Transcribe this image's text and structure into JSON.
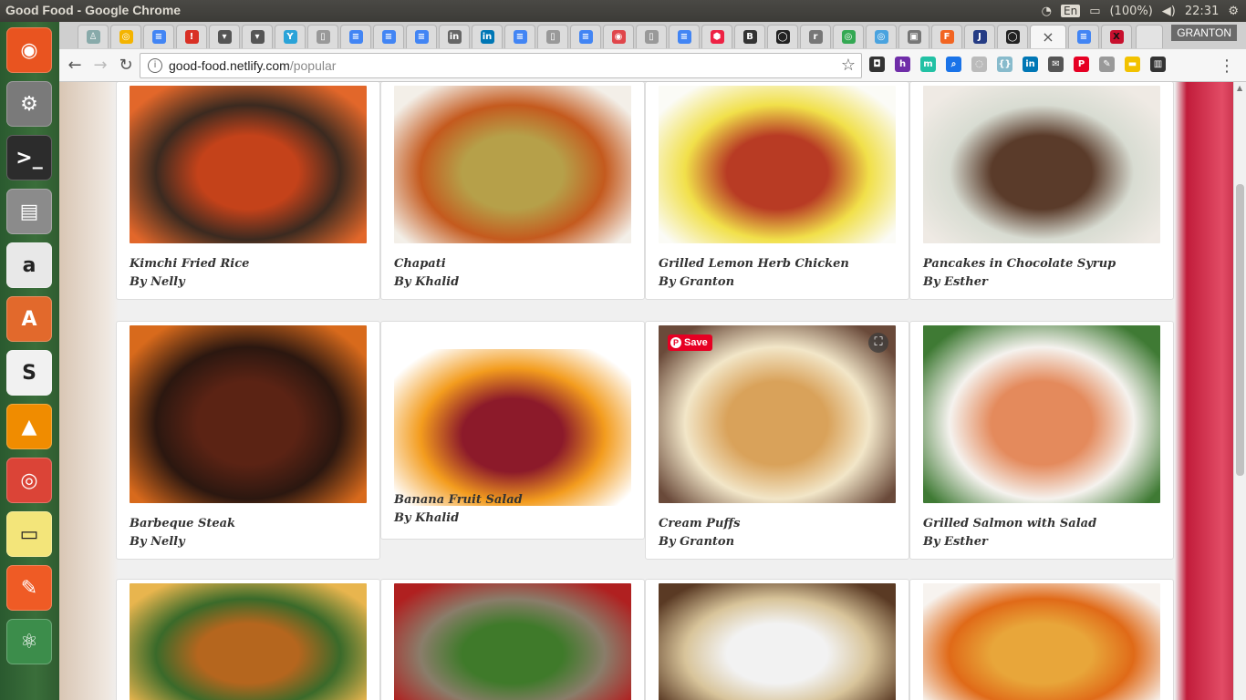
{
  "os": {
    "window_title": "Good Food - Google Chrome",
    "lang": "En",
    "battery": "(100%)",
    "clock": "22:31"
  },
  "launcher": [
    {
      "name": "ubuntu-dash-icon",
      "glyph": "◉",
      "color": "#e95420"
    },
    {
      "name": "system-settings-icon",
      "glyph": "⚙",
      "color": "#7a7a7a"
    },
    {
      "name": "terminal-icon",
      "glyph": ">_",
      "color": "#2c2c2c"
    },
    {
      "name": "files-icon",
      "glyph": "▤",
      "color": "#8b8b8b"
    },
    {
      "name": "amazon-icon",
      "glyph": "a",
      "color": "#e8e8e8"
    },
    {
      "name": "software-center-icon",
      "glyph": "A",
      "color": "#e2692c"
    },
    {
      "name": "slack-icon",
      "glyph": "S",
      "color": "#f1f1f1"
    },
    {
      "name": "vlc-icon",
      "glyph": "▲",
      "color": "#f08c00"
    },
    {
      "name": "chrome-icon",
      "glyph": "◎",
      "color": "#db4437"
    },
    {
      "name": "sticky-notes-icon",
      "glyph": "▭",
      "color": "#f3e57a"
    },
    {
      "name": "postman-icon",
      "glyph": "✎",
      "color": "#ef5b25"
    },
    {
      "name": "atom-icon",
      "glyph": "⚛",
      "color": "#3c8d4b"
    }
  ],
  "browser": {
    "tabs": [
      {
        "name": "tab-app",
        "glyph": "♙",
        "color": "#8aa",
        "fg": "#fff"
      },
      {
        "name": "tab-chrome",
        "glyph": "◎",
        "color": "#f4b400",
        "fg": "#fff"
      },
      {
        "name": "tab-docs-1",
        "glyph": "≡",
        "color": "#4285f4",
        "fg": "#fff"
      },
      {
        "name": "tab-alert",
        "glyph": "!",
        "color": "#d93025",
        "fg": "#fff"
      },
      {
        "name": "tab-pocket-1",
        "glyph": "▾",
        "color": "#555",
        "fg": "#fff"
      },
      {
        "name": "tab-pocket-2",
        "glyph": "▾",
        "color": "#555",
        "fg": "#fff"
      },
      {
        "name": "tab-y",
        "glyph": "Y",
        "color": "#2aa3d8",
        "fg": "#fff"
      },
      {
        "name": "tab-page-1",
        "glyph": "▯",
        "color": "#999",
        "fg": "#fff"
      },
      {
        "name": "tab-docs-2",
        "glyph": "≡",
        "color": "#4285f4",
        "fg": "#fff"
      },
      {
        "name": "tab-docs-3",
        "glyph": "≡",
        "color": "#4285f4",
        "fg": "#fff"
      },
      {
        "name": "tab-docs-4",
        "glyph": "≡",
        "color": "#4285f4",
        "fg": "#fff"
      },
      {
        "name": "tab-linkedin-1",
        "glyph": "in",
        "color": "#666",
        "fg": "#fff"
      },
      {
        "name": "tab-linkedin-2",
        "glyph": "in",
        "color": "#0077b5",
        "fg": "#fff"
      },
      {
        "name": "tab-docs-5",
        "glyph": "≡",
        "color": "#4285f4",
        "fg": "#fff"
      },
      {
        "name": "tab-page-2",
        "glyph": "▯",
        "color": "#999",
        "fg": "#fff"
      },
      {
        "name": "tab-docs-6",
        "glyph": "≡",
        "color": "#4285f4",
        "fg": "#fff"
      },
      {
        "name": "tab-spiral",
        "glyph": "◉",
        "color": "#e0464b",
        "fg": "#fff"
      },
      {
        "name": "tab-page-3",
        "glyph": "▯",
        "color": "#999",
        "fg": "#fff"
      },
      {
        "name": "tab-docs-7",
        "glyph": "≡",
        "color": "#4285f4",
        "fg": "#fff"
      },
      {
        "name": "tab-red-hex",
        "glyph": "⬢",
        "color": "#ee2244",
        "fg": "#fff"
      },
      {
        "name": "tab-b",
        "glyph": "B",
        "color": "#333",
        "fg": "#fff"
      },
      {
        "name": "tab-github-1",
        "glyph": "◯",
        "color": "#222",
        "fg": "#fff"
      },
      {
        "name": "tab-r",
        "glyph": "r",
        "color": "#777",
        "fg": "#fff"
      },
      {
        "name": "tab-chrome-2",
        "glyph": "◎",
        "color": "#34a853",
        "fg": "#fff"
      },
      {
        "name": "tab-chrome-3",
        "glyph": "◎",
        "color": "#4aa3df",
        "fg": "#fff"
      },
      {
        "name": "tab-puzzle",
        "glyph": "▣",
        "color": "#777",
        "fg": "#fff"
      },
      {
        "name": "tab-f",
        "glyph": "F",
        "color": "#f26522",
        "fg": "#fff"
      },
      {
        "name": "tab-j",
        "glyph": "J",
        "color": "#253c84",
        "fg": "#fff"
      },
      {
        "name": "tab-github-2",
        "glyph": "◯",
        "color": "#222",
        "fg": "#fff"
      }
    ],
    "active_tab_close": "×",
    "after_tabs": [
      {
        "name": "tab-docs-8",
        "glyph": "≡",
        "color": "#4285f4",
        "fg": "#fff"
      },
      {
        "name": "tab-x",
        "glyph": "X",
        "color": "#c8102e",
        "fg": "#111"
      }
    ],
    "profile": "GRANTON",
    "url_host": "good-food.netlify.com",
    "url_path": "/popular",
    "extensions": [
      {
        "name": "instagram-ext-icon",
        "glyph": "◘",
        "color": "#333"
      },
      {
        "name": "h-ext-icon",
        "glyph": "h",
        "color": "#6f2da8"
      },
      {
        "name": "m-ext-icon",
        "glyph": "m",
        "color": "#22c1a4"
      },
      {
        "name": "search-ext-icon",
        "glyph": "⌕",
        "color": "#1a73e8"
      },
      {
        "name": "circle-ext-icon",
        "glyph": "◌",
        "color": "#bbb"
      },
      {
        "name": "json-ext-icon",
        "glyph": "{}",
        "color": "#8bc"
      },
      {
        "name": "linkedin-ext-icon",
        "glyph": "in",
        "color": "#0077b5"
      },
      {
        "name": "mail-ext-icon",
        "glyph": "✉",
        "color": "#555"
      },
      {
        "name": "pinterest-ext-icon",
        "glyph": "P",
        "color": "#e60023"
      },
      {
        "name": "pen-ext-icon",
        "glyph": "✎",
        "color": "#999"
      },
      {
        "name": "yellow-ext-icon",
        "glyph": "▬",
        "color": "#f2c200"
      },
      {
        "name": "film-ext-icon",
        "glyph": "▥",
        "color": "#333"
      }
    ]
  },
  "recipes": [
    {
      "title": "Kimchi Fried Rice",
      "author": "By Nelly",
      "palette": [
        "#c4421a",
        "#e2672a",
        "#3b2a20"
      ]
    },
    {
      "title": "Chapati",
      "author": "By Khalid",
      "palette": [
        "#b6a049",
        "#f3efe8",
        "#c45a1e"
      ]
    },
    {
      "title": "Grilled Lemon Herb Chicken",
      "author": "By Granton",
      "palette": [
        "#b83b24",
        "#fbfbf6",
        "#f1e04a"
      ]
    },
    {
      "title": "Pancakes in Chocolate Syrup",
      "author": "By Esther",
      "palette": [
        "#5a3b2a",
        "#efeae4",
        "#d8dcd2"
      ]
    },
    {
      "title": "Barbeque Steak",
      "author": "By Nelly",
      "palette": [
        "#5b2314",
        "#d86a1c",
        "#2b1710"
      ]
    },
    {
      "title": "Banana Fruit Salad",
      "author": "By Khalid",
      "palette": [
        "#8c1a2a",
        "#ffffff",
        "#f39c1e"
      ]
    },
    {
      "title": "Cream Puffs",
      "author": "By Granton",
      "palette": [
        "#d9a25a",
        "#6a4a3a",
        "#f2e6c8"
      ]
    },
    {
      "title": "Grilled Salmon with Salad",
      "author": "By Esther",
      "palette": [
        "#e48a5c",
        "#3f7a34",
        "#f5f2ee"
      ]
    },
    {
      "title": "",
      "author": "",
      "palette": [
        "#b5661e",
        "#e8b54e",
        "#3a6a2a"
      ]
    },
    {
      "title": "",
      "author": "",
      "palette": [
        "#3f7a2a",
        "#b02020",
        "#8a7d6a"
      ]
    },
    {
      "title": "",
      "author": "",
      "palette": [
        "#f2f2f2",
        "#5a3a24",
        "#d8c49a"
      ]
    },
    {
      "title": "",
      "author": "",
      "palette": [
        "#e8a63a",
        "#f7f3ef",
        "#e06a18"
      ]
    }
  ],
  "pin_save_label": "Save"
}
